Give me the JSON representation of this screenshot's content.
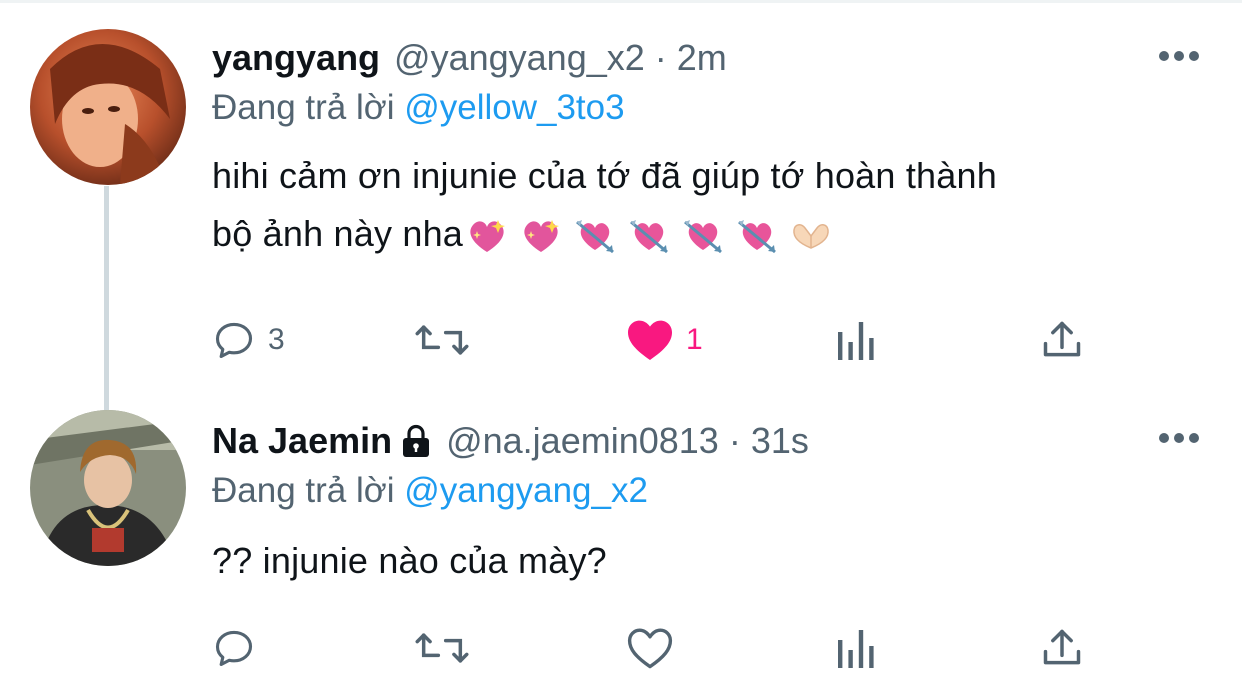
{
  "tweets": [
    {
      "display_name": "yangyang",
      "handle": "@yangyang_x2",
      "separator": "·",
      "time": "2m",
      "reply_prefix": "Đang trả lời",
      "reply_to": "@yellow_3to3",
      "text": "hihi cảm ơn injunie của tớ đã giúp tớ hoàn thành\nbộ ảnh này nha",
      "emojis": [
        "sparkling-heart",
        "sparkling-heart",
        "heart-with-arrow",
        "heart-with-arrow",
        "heart-with-arrow",
        "heart-with-arrow",
        "heart-hands"
      ],
      "reply_count": "3",
      "retweet_count": "",
      "like_count": "1",
      "liked": true,
      "locked": false,
      "icons": [
        "avatar",
        "more-icon",
        "reply-icon",
        "retweet-icon",
        "like-icon",
        "analytics-icon",
        "share-icon"
      ]
    },
    {
      "display_name": "Na Jaemin",
      "handle": "@na.jaemin0813",
      "separator": "·",
      "time": "31s",
      "reply_prefix": "Đang trả lời",
      "reply_to": "@yangyang_x2",
      "text": "?? injunie nào của mày?",
      "reply_count": "",
      "retweet_count": "",
      "like_count": "",
      "liked": false,
      "locked": true,
      "icons": [
        "avatar",
        "lock-icon",
        "more-icon",
        "reply-icon",
        "retweet-icon",
        "like-icon",
        "analytics-icon",
        "share-icon"
      ]
    }
  ],
  "colors": {
    "link": "#1d9bf0",
    "secondary_text": "#536471",
    "primary_text": "#0f1419",
    "like_active": "#f91880",
    "thread_line": "#cfd9de"
  }
}
